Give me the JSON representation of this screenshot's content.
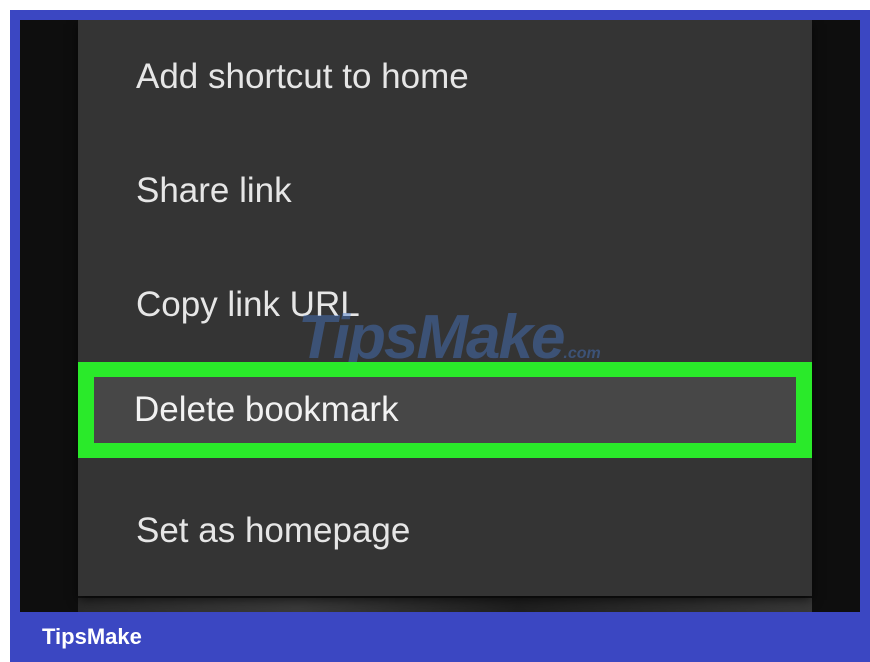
{
  "menu": {
    "items": [
      {
        "label": "Add shortcut to home"
      },
      {
        "label": "Share link"
      },
      {
        "label": "Copy link URL"
      },
      {
        "label": "Delete bookmark",
        "highlighted": true
      },
      {
        "label": "Set as homepage"
      }
    ]
  },
  "watermark": {
    "text": "TipsMake",
    "suffix": ".com"
  },
  "footer": {
    "brand": "TipsMake"
  },
  "colors": {
    "frame": "#3b47c2",
    "menu_bg": "#343434",
    "highlight_border": "#2aea2a",
    "highlight_fill": "#474747",
    "text": "#e6e6e6"
  }
}
